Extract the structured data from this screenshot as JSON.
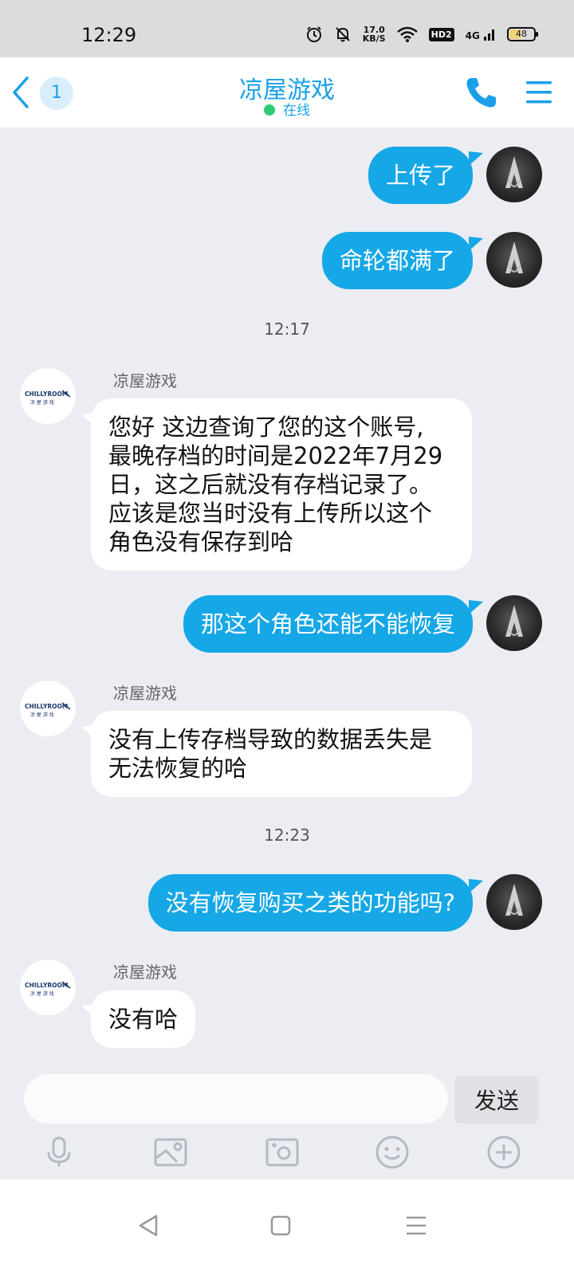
{
  "status_bar": {
    "time": "12:29",
    "net_speed_value": "17.0",
    "net_speed_unit": "KB/S",
    "hd_badge": "HD2",
    "signal_label": "4G",
    "battery_level": "48",
    "icons": [
      "alarm-icon",
      "mute-icon",
      "wifi-icon",
      "hd-icon",
      "signal-icon",
      "battery-icon"
    ]
  },
  "header": {
    "unread_count": "1",
    "title": "凉屋游戏",
    "presence": "在线",
    "accent_color": "#1aa0e8"
  },
  "messages": [
    {
      "type": "out",
      "text": "上传了"
    },
    {
      "type": "out",
      "text": "命轮都满了"
    },
    {
      "type": "time",
      "text": "12:17"
    },
    {
      "type": "in",
      "sender": "凉屋游戏",
      "lines": [
        "您好 这边查询了您的这个账号,",
        "最晚存档的时间是2022年7月29",
        "日，这之后就没有存档记录了。",
        "应该是您当时没有上传所以这个",
        "角色没有保存到哈"
      ]
    },
    {
      "type": "out",
      "text": "那这个角色还能不能恢复"
    },
    {
      "type": "in",
      "sender": "凉屋游戏",
      "lines": [
        "没有上传存档导致的数据丢失是",
        "无法恢复的哈"
      ]
    },
    {
      "type": "time",
      "text": "12:23"
    },
    {
      "type": "out",
      "text": "没有恢复购买之类的功能吗?"
    },
    {
      "type": "in",
      "sender": "凉屋游戏",
      "lines": [
        "没有哈"
      ]
    }
  ],
  "shop_logo": {
    "brand": "CHILLYROOM",
    "sub": "凉 屋 游 戏"
  },
  "input_bar": {
    "placeholder": "",
    "send_label": "发送",
    "tools": [
      "microphone-icon",
      "image-icon",
      "camera-icon",
      "emoji-icon",
      "plus-icon"
    ]
  },
  "nav_bar": {
    "buttons": [
      "back-nav-icon",
      "home-nav-icon",
      "recents-nav-icon"
    ]
  },
  "colors": {
    "out_bubble": "#16a7e6",
    "in_bubble": "#ffffff",
    "background": "#ebedf2",
    "online_dot": "#2ecc71"
  }
}
